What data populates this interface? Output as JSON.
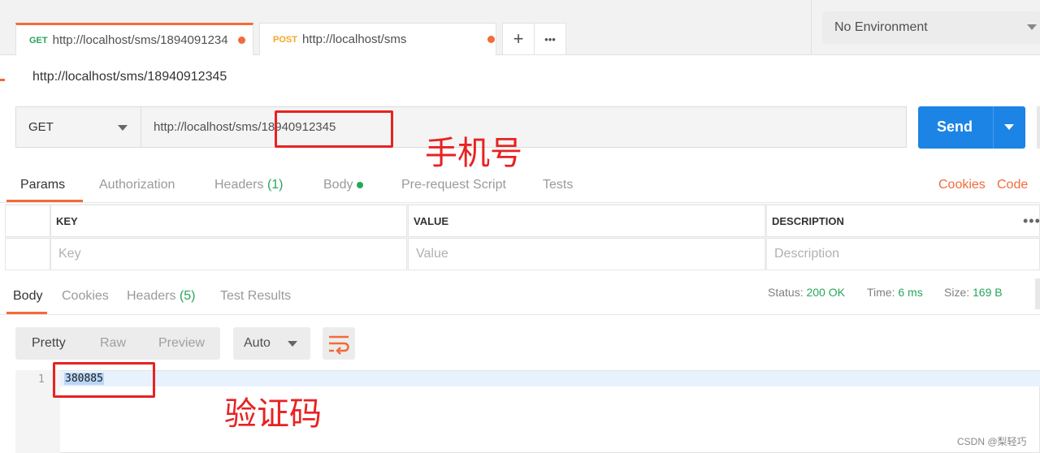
{
  "tabs": [
    {
      "method": "GET",
      "url": "http://localhost/sms/1894091234"
    },
    {
      "method": "POST",
      "url": "http://localhost/sms"
    }
  ],
  "tab_actions": {
    "add": "+",
    "more": "•••"
  },
  "environment": {
    "selected": "No Environment"
  },
  "request": {
    "title": "http://localhost/sms/18940912345",
    "method": "GET",
    "url_prefix": "http://localhost/sms/",
    "url_phone": "18940912345",
    "send_label": "Send"
  },
  "request_tabs": {
    "params": "Params",
    "authorization": "Authorization",
    "headers": "Headers",
    "headers_count": "(1)",
    "body": "Body",
    "prerequest": "Pre-request Script",
    "tests": "Tests",
    "cookies": "Cookies",
    "code": "Code"
  },
  "params_table": {
    "headers": [
      "KEY",
      "VALUE",
      "DESCRIPTION"
    ],
    "placeholders": [
      "Key",
      "Value",
      "Description"
    ],
    "more": "•••"
  },
  "response": {
    "tabs": {
      "body": "Body",
      "cookies": "Cookies",
      "headers": "Headers",
      "headers_count": "(5)",
      "test_results": "Test Results"
    },
    "status_label": "Status:",
    "status_value": "200 OK",
    "time_label": "Time:",
    "time_value": "6 ms",
    "size_label": "Size:",
    "size_value": "169 B",
    "view_modes": [
      "Pretty",
      "Raw",
      "Preview"
    ],
    "format": "Auto",
    "line_number": "1",
    "body_text": "380885"
  },
  "annotations": {
    "phone_label": "手机号",
    "code_label": "验证码"
  },
  "watermark": "CSDN @梨轻巧",
  "colors": {
    "accent": "#f26b3a",
    "send": "#1b84e5",
    "success": "#26a65b",
    "annotation": "#e82222"
  }
}
